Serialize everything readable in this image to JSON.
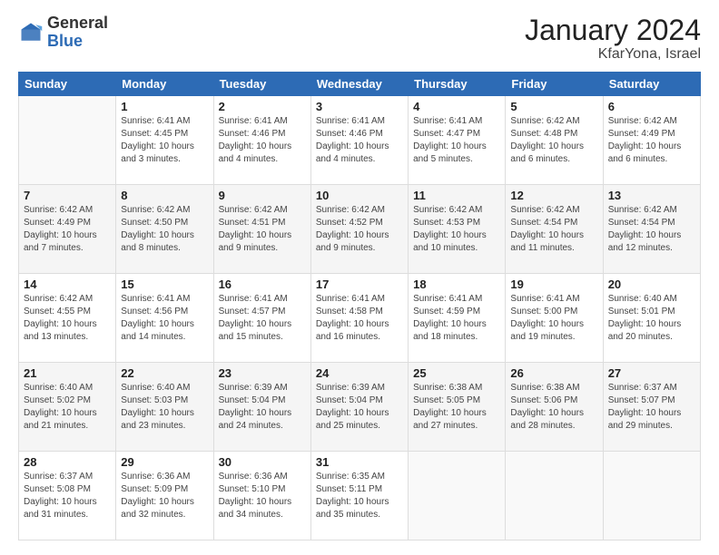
{
  "header": {
    "logo_line1": "General",
    "logo_line2": "Blue",
    "month": "January 2024",
    "location": "KfarYona, Israel"
  },
  "weekdays": [
    "Sunday",
    "Monday",
    "Tuesday",
    "Wednesday",
    "Thursday",
    "Friday",
    "Saturday"
  ],
  "weeks": [
    [
      {
        "day": "",
        "info": ""
      },
      {
        "day": "1",
        "info": "Sunrise: 6:41 AM\nSunset: 4:45 PM\nDaylight: 10 hours\nand 3 minutes."
      },
      {
        "day": "2",
        "info": "Sunrise: 6:41 AM\nSunset: 4:46 PM\nDaylight: 10 hours\nand 4 minutes."
      },
      {
        "day": "3",
        "info": "Sunrise: 6:41 AM\nSunset: 4:46 PM\nDaylight: 10 hours\nand 4 minutes."
      },
      {
        "day": "4",
        "info": "Sunrise: 6:41 AM\nSunset: 4:47 PM\nDaylight: 10 hours\nand 5 minutes."
      },
      {
        "day": "5",
        "info": "Sunrise: 6:42 AM\nSunset: 4:48 PM\nDaylight: 10 hours\nand 6 minutes."
      },
      {
        "day": "6",
        "info": "Sunrise: 6:42 AM\nSunset: 4:49 PM\nDaylight: 10 hours\nand 6 minutes."
      }
    ],
    [
      {
        "day": "7",
        "info": "Sunrise: 6:42 AM\nSunset: 4:49 PM\nDaylight: 10 hours\nand 7 minutes."
      },
      {
        "day": "8",
        "info": "Sunrise: 6:42 AM\nSunset: 4:50 PM\nDaylight: 10 hours\nand 8 minutes."
      },
      {
        "day": "9",
        "info": "Sunrise: 6:42 AM\nSunset: 4:51 PM\nDaylight: 10 hours\nand 9 minutes."
      },
      {
        "day": "10",
        "info": "Sunrise: 6:42 AM\nSunset: 4:52 PM\nDaylight: 10 hours\nand 9 minutes."
      },
      {
        "day": "11",
        "info": "Sunrise: 6:42 AM\nSunset: 4:53 PM\nDaylight: 10 hours\nand 10 minutes."
      },
      {
        "day": "12",
        "info": "Sunrise: 6:42 AM\nSunset: 4:54 PM\nDaylight: 10 hours\nand 11 minutes."
      },
      {
        "day": "13",
        "info": "Sunrise: 6:42 AM\nSunset: 4:54 PM\nDaylight: 10 hours\nand 12 minutes."
      }
    ],
    [
      {
        "day": "14",
        "info": "Sunrise: 6:42 AM\nSunset: 4:55 PM\nDaylight: 10 hours\nand 13 minutes."
      },
      {
        "day": "15",
        "info": "Sunrise: 6:41 AM\nSunset: 4:56 PM\nDaylight: 10 hours\nand 14 minutes."
      },
      {
        "day": "16",
        "info": "Sunrise: 6:41 AM\nSunset: 4:57 PM\nDaylight: 10 hours\nand 15 minutes."
      },
      {
        "day": "17",
        "info": "Sunrise: 6:41 AM\nSunset: 4:58 PM\nDaylight: 10 hours\nand 16 minutes."
      },
      {
        "day": "18",
        "info": "Sunrise: 6:41 AM\nSunset: 4:59 PM\nDaylight: 10 hours\nand 18 minutes."
      },
      {
        "day": "19",
        "info": "Sunrise: 6:41 AM\nSunset: 5:00 PM\nDaylight: 10 hours\nand 19 minutes."
      },
      {
        "day": "20",
        "info": "Sunrise: 6:40 AM\nSunset: 5:01 PM\nDaylight: 10 hours\nand 20 minutes."
      }
    ],
    [
      {
        "day": "21",
        "info": "Sunrise: 6:40 AM\nSunset: 5:02 PM\nDaylight: 10 hours\nand 21 minutes."
      },
      {
        "day": "22",
        "info": "Sunrise: 6:40 AM\nSunset: 5:03 PM\nDaylight: 10 hours\nand 23 minutes."
      },
      {
        "day": "23",
        "info": "Sunrise: 6:39 AM\nSunset: 5:04 PM\nDaylight: 10 hours\nand 24 minutes."
      },
      {
        "day": "24",
        "info": "Sunrise: 6:39 AM\nSunset: 5:04 PM\nDaylight: 10 hours\nand 25 minutes."
      },
      {
        "day": "25",
        "info": "Sunrise: 6:38 AM\nSunset: 5:05 PM\nDaylight: 10 hours\nand 27 minutes."
      },
      {
        "day": "26",
        "info": "Sunrise: 6:38 AM\nSunset: 5:06 PM\nDaylight: 10 hours\nand 28 minutes."
      },
      {
        "day": "27",
        "info": "Sunrise: 6:37 AM\nSunset: 5:07 PM\nDaylight: 10 hours\nand 29 minutes."
      }
    ],
    [
      {
        "day": "28",
        "info": "Sunrise: 6:37 AM\nSunset: 5:08 PM\nDaylight: 10 hours\nand 31 minutes."
      },
      {
        "day": "29",
        "info": "Sunrise: 6:36 AM\nSunset: 5:09 PM\nDaylight: 10 hours\nand 32 minutes."
      },
      {
        "day": "30",
        "info": "Sunrise: 6:36 AM\nSunset: 5:10 PM\nDaylight: 10 hours\nand 34 minutes."
      },
      {
        "day": "31",
        "info": "Sunrise: 6:35 AM\nSunset: 5:11 PM\nDaylight: 10 hours\nand 35 minutes."
      },
      {
        "day": "",
        "info": ""
      },
      {
        "day": "",
        "info": ""
      },
      {
        "day": "",
        "info": ""
      }
    ]
  ]
}
